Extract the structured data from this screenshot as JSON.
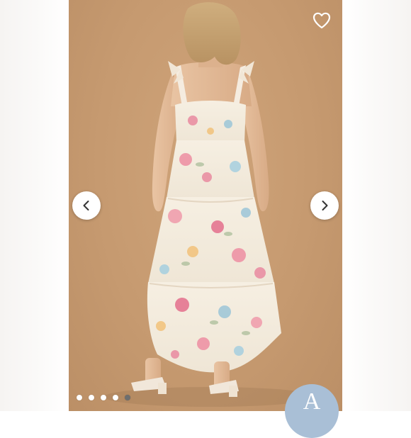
{
  "product_image": {
    "alt": "",
    "total_images": 5,
    "active_index": 4
  },
  "controls": {
    "favorite_icon": "heart-outline-icon",
    "prev_icon": "chevron-left-icon",
    "next_icon": "chevron-right-icon"
  },
  "brand_badge": {
    "letter": "A"
  },
  "colors": {
    "backdrop": "#c69a70",
    "dress_base": "#f3ebdc",
    "active_dot": "#6e6e6e",
    "badge": "#a9bfd6"
  }
}
